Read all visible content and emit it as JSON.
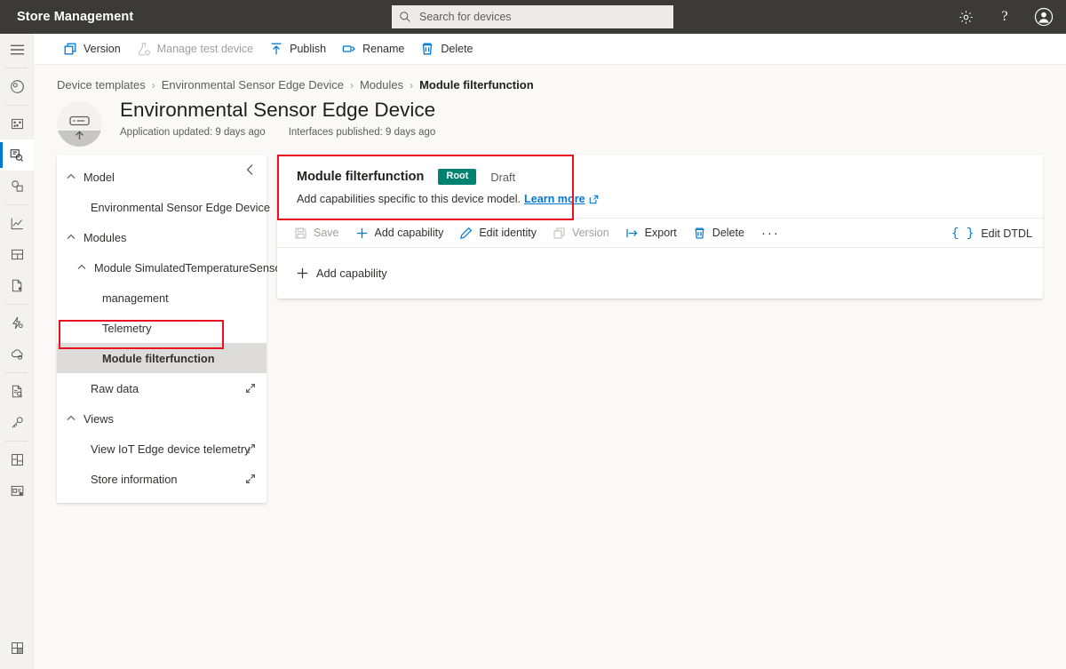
{
  "app": {
    "title": "Store Management",
    "accent_blue": "#0078d4",
    "header_bg": "#3b3a39",
    "badge_teal": "#008272",
    "annotation_red": "#e81123"
  },
  "search": {
    "placeholder": "Search for devices",
    "value": "",
    "icon": "search-icon"
  },
  "topbar_actions": [
    {
      "icon": "gear-icon",
      "label": "Settings"
    },
    {
      "icon": "help-question-icon",
      "label": "Help"
    },
    {
      "icon": "account-avatar-icon",
      "label": "Account"
    }
  ],
  "rail": {
    "hamburger": "hamburger-menu-icon",
    "groups": [
      [
        {
          "icon": "dashboard-icon",
          "name": "dashboard",
          "selected": false
        }
      ],
      [
        {
          "icon": "devices-icon",
          "name": "devices",
          "selected": false
        },
        {
          "icon": "device-templates-icon",
          "name": "device-templates",
          "selected": true
        },
        {
          "icon": "device-groups-icon",
          "name": "device-groups",
          "selected": false
        }
      ],
      [
        {
          "icon": "analytics-icon",
          "name": "analytics",
          "selected": false
        },
        {
          "icon": "dashboards-icon",
          "name": "dashboards",
          "selected": false
        },
        {
          "icon": "jobs-icon",
          "name": "jobs",
          "selected": false
        }
      ],
      [
        {
          "icon": "rules-icon",
          "name": "rules",
          "selected": false
        },
        {
          "icon": "data-export-icon",
          "name": "data-export",
          "selected": false
        }
      ],
      [
        {
          "icon": "audit-log-icon",
          "name": "audit-log",
          "selected": false
        },
        {
          "icon": "permissions-key-icon",
          "name": "permissions",
          "selected": false
        }
      ],
      [
        {
          "icon": "app-templates-icon",
          "name": "app-templates",
          "selected": false
        },
        {
          "icon": "customize-app-icon",
          "name": "customize-app",
          "selected": false
        }
      ]
    ],
    "bottom": {
      "icon": "app-settings-icon",
      "name": "administration"
    }
  },
  "commandbar": [
    {
      "label": "Version",
      "icon": "version-copy-icon",
      "disabled": false
    },
    {
      "label": "Manage test device",
      "icon": "test-device-flask-icon",
      "disabled": true
    },
    {
      "label": "Publish",
      "icon": "publish-up-arrow-icon",
      "disabled": false
    },
    {
      "label": "Rename",
      "icon": "rename-tag-icon",
      "disabled": false
    },
    {
      "label": "Delete",
      "icon": "delete-trash-icon",
      "disabled": false
    }
  ],
  "breadcrumb": [
    {
      "label": "Device templates",
      "current": false
    },
    {
      "label": "Environmental Sensor Edge Device",
      "current": false
    },
    {
      "label": "Modules",
      "current": false
    },
    {
      "label": "Module filterfunction",
      "current": true
    }
  ],
  "breadcrumb_separator": "›",
  "header": {
    "avatar_icon": "iot-edge-device-icon",
    "title": "Environmental Sensor Edge Device",
    "meta": [
      "Application updated: 9 days ago",
      "Interfaces published: 9 days ago"
    ]
  },
  "tree": {
    "collapse_icon": "collapse-panel-chevron-left-icon",
    "nodes": [
      {
        "label": "Model",
        "level": 0,
        "type": "group",
        "expanded": true,
        "selected": false
      },
      {
        "label": "Environmental Sensor Edge Device",
        "level": 1,
        "type": "leaf",
        "selected": false
      },
      {
        "label": "Modules",
        "level": 0,
        "type": "group",
        "expanded": true,
        "selected": false
      },
      {
        "label": "Module SimulatedTemperatureSensor",
        "level": 1,
        "type": "group",
        "expanded": true,
        "selected": false
      },
      {
        "label": "management",
        "level": 2,
        "type": "leaf",
        "selected": false
      },
      {
        "label": "Telemetry",
        "level": 2,
        "type": "leaf",
        "selected": false
      },
      {
        "label": "Module filterfunction",
        "level": 2,
        "type": "leaf",
        "selected": true
      },
      {
        "label": "Raw data",
        "level": 1,
        "type": "leaf",
        "selected": false,
        "action_icon": "open-expand-icon"
      },
      {
        "label": "Views",
        "level": 0,
        "type": "group",
        "expanded": true,
        "selected": false
      },
      {
        "label": "View IoT Edge device telemetry",
        "level": 1,
        "type": "leaf",
        "selected": false,
        "action_icon": "open-expand-icon"
      },
      {
        "label": "Store information",
        "level": 1,
        "type": "leaf",
        "selected": false,
        "action_icon": "open-expand-icon"
      }
    ]
  },
  "card": {
    "name": "Module filterfunction",
    "badge": "Root",
    "state": "Draft",
    "description": "Add capabilities specific to this device model.",
    "learn_more": "Learn more",
    "learn_more_icon": "external-link-icon",
    "toolbar": [
      {
        "label": "Save",
        "icon": "save-disk-icon",
        "disabled": true
      },
      {
        "label": "Add capability",
        "icon": "plus-icon",
        "disabled": false
      },
      {
        "label": "Edit identity",
        "icon": "edit-pencil-icon",
        "disabled": false
      },
      {
        "label": "Version",
        "icon": "version-copy-icon",
        "disabled": true
      },
      {
        "label": "Export",
        "icon": "export-arrow-icon",
        "disabled": false
      },
      {
        "label": "Delete",
        "icon": "delete-trash-icon",
        "disabled": false
      }
    ],
    "overflow": "···",
    "edit_dtdl": {
      "label": "Edit DTDL",
      "icon": "curly-braces-icon"
    },
    "body_action": {
      "label": "Add capability",
      "icon": "plus-icon"
    }
  }
}
